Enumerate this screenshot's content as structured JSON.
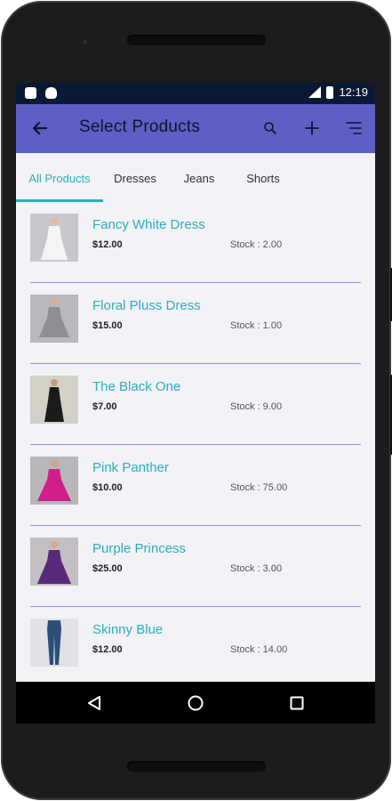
{
  "status_bar": {
    "time": "12:19"
  },
  "app_bar": {
    "title": "Select Products"
  },
  "tabs": [
    {
      "label": "All Products",
      "active": true
    },
    {
      "label": "Dresses",
      "active": false
    },
    {
      "label": "Jeans",
      "active": false
    },
    {
      "label": "Shorts",
      "active": false
    }
  ],
  "products": [
    {
      "name": "Fancy White Dress",
      "price": "$12.00",
      "stock": "Stock : 2.00",
      "dress_color": "#f4f4f4"
    },
    {
      "name": "Floral Pluss Dress",
      "price": "$15.00",
      "stock": "Stock : 1.00",
      "dress_color": "#8d8f93"
    },
    {
      "name": "The Black One",
      "price": "$7.00",
      "stock": "Stock : 9.00",
      "dress_color": "#1b1b1b"
    },
    {
      "name": "Pink Panther",
      "price": "$10.00",
      "stock": "Stock : 75.00",
      "dress_color": "#d01e8a"
    },
    {
      "name": "Purple Princess",
      "price": "$25.00",
      "stock": "Stock : 3.00",
      "dress_color": "#5a2a7a"
    },
    {
      "name": "Skinny Blue",
      "price": "$12.00",
      "stock": "Stock : 14.00",
      "dress_color": "#2b4f7a"
    }
  ],
  "colors": {
    "app_bar": "#5c5fc4",
    "accent": "#2aaebd",
    "divider": "#9c8fe8",
    "background": "#f2f2f7",
    "status_bar": "#0a1933"
  },
  "icons": {
    "back": "arrow-left-icon",
    "search": "search-icon",
    "add": "plus-icon",
    "menu": "menu-lines-icon",
    "nav_back": "triangle-back-icon",
    "nav_home": "circle-home-icon",
    "nav_recent": "square-recent-icon"
  }
}
